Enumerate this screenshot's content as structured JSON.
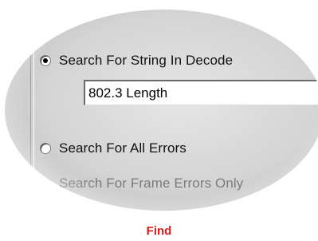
{
  "options": {
    "search_string_label": "Search For String In Decode",
    "search_string_value": "802.3 Length",
    "all_errors_label": "Search For All Errors",
    "frame_errors_label": "Search For Frame Errors Only"
  },
  "caption": {
    "find_label": "Find"
  },
  "colors": {
    "accent_red": "#e01a1a"
  }
}
